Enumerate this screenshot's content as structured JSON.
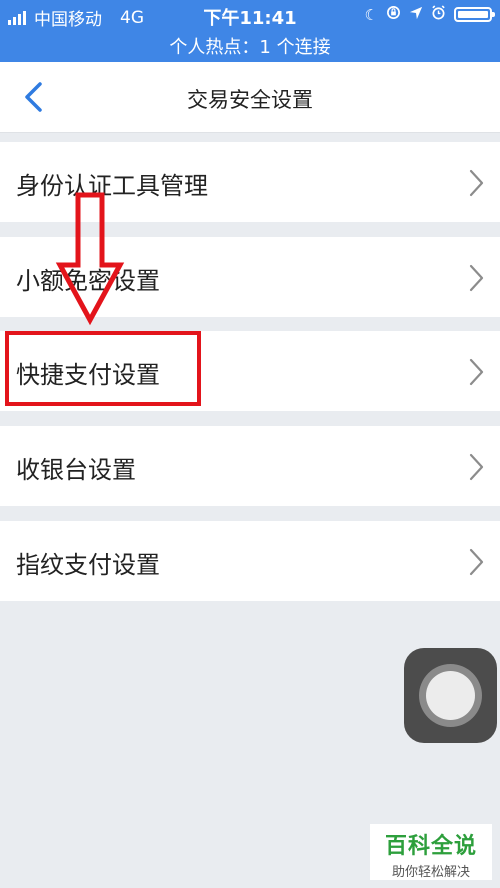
{
  "status_bar": {
    "carrier": "中国移动",
    "network": "4G",
    "time": "下午11:41",
    "hotspot_text": "个人热点：1 个连接",
    "icons": [
      "signal-icon",
      "moon-icon",
      "rotation-lock-icon",
      "location-icon",
      "alarm-icon",
      "battery-icon"
    ]
  },
  "nav": {
    "title": "交易安全设置",
    "back_icon": "chevron-left-icon"
  },
  "menu": {
    "items": [
      {
        "label": "身份认证工具管理"
      },
      {
        "label": "小额免密设置"
      },
      {
        "label": "快捷支付设置"
      },
      {
        "label": "收银台设置"
      },
      {
        "label": "指纹支付设置"
      }
    ]
  },
  "annotation": {
    "highlight_color": "#e3141b",
    "highlighted_item": "快捷支付设置"
  },
  "watermark": {
    "title": "百科全说",
    "subtitle": "助你轻松解决"
  },
  "colors": {
    "status_bar": "#3f86e6",
    "accent": "#2f7be0",
    "background": "#e9ecf0"
  }
}
